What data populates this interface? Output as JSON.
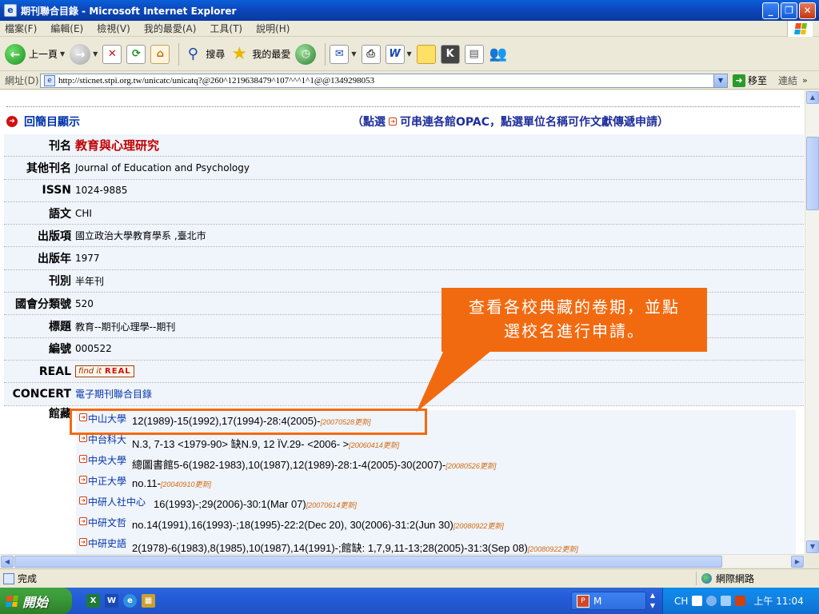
{
  "window": {
    "title": "期刊聯合目錄 - Microsoft Internet Explorer",
    "buttons": [
      "_",
      "❐",
      "✕"
    ]
  },
  "menu": [
    "檔案(F)",
    "編輯(E)",
    "檢視(V)",
    "我的最愛(A)",
    "工具(T)",
    "說明(H)"
  ],
  "toolbar": {
    "back_label": "上一頁",
    "search_label": "搜尋",
    "favorites_label": "我的最愛"
  },
  "address": {
    "label": "網址(D)",
    "url": "http://sticnet.stpi.org.tw/unicatc/unicatq?@260^1219638479^107^^^1^1@@1349298053",
    "go_label": "移至",
    "links_label": "連結"
  },
  "page": {
    "back_label": "回簡目顯示",
    "hint_prefix": "（點選",
    "hint_suffix": "可串連各館OPAC，點選單位名稱可作文獻傳遞申請）",
    "fields": [
      {
        "key": "刊名",
        "value": "教育與心理研究"
      },
      {
        "key": "其他刊名",
        "value": "Journal of Education and Psychology"
      },
      {
        "key": "ISSN",
        "value": "1024-9885"
      },
      {
        "key": "語文",
        "value": "CHI"
      },
      {
        "key": "出版項",
        "value": "國立政治大學教育學系 ,臺北市"
      },
      {
        "key": "出版年",
        "value": "1977"
      },
      {
        "key": "刊別",
        "value": "半年刊"
      },
      {
        "key": "國會分類號",
        "value": "520"
      },
      {
        "key": "標題",
        "value": "教育--期刊心理學--期刊"
      },
      {
        "key": "編號",
        "value": "000522"
      },
      {
        "key": "REAL",
        "findit": "find it",
        "real": "REAL"
      },
      {
        "key": "CONCERT",
        "value": "電子期刊聯合目錄"
      }
    ],
    "holdings_key": "館藏",
    "holdings": [
      {
        "lib": "中山大學",
        "vols": "12(1989)-15(1992),17(1994)-28:4(2005)-",
        "updated": "[20070528更新]"
      },
      {
        "lib": "中台科大",
        "vols": "N.3, 7-13 <1979-90> 缺N.9, 12 ÏV.29- <2006- >",
        "updated": "[20060414更新]"
      },
      {
        "lib": "中央大學",
        "vols": "總圖書館5-6(1982-1983),10(1987),12(1989)-28:1-4(2005)-30(2007)-",
        "updated": "[20080526更新]"
      },
      {
        "lib": "中正大學",
        "vols": "no.11-",
        "updated": "[20040910更新]"
      },
      {
        "lib": "中研人社中心",
        "vols": "16(1993)-;29(2006)-30:1(Mar 07)",
        "updated": "[20070614更新]"
      },
      {
        "lib": "中研文哲",
        "vols": "no.14(1991),16(1993)-;18(1995)-22:2(Dec 20), 30(2006)-31:2(Jun 30)",
        "updated": "[20080922更新]"
      },
      {
        "lib": "中研史語",
        "vols": "2(1978)-6(1983),8(1985),10(1987),14(1991)-;館缺: 1,7,9,11-13;28(2005)-31:3(Sep 08)",
        "updated": "[20080922更新]"
      }
    ]
  },
  "callout": {
    "line1": "查看各校典藏的卷期，並點",
    "line2": "選校名進行申請。"
  },
  "status": {
    "text": "完成",
    "zone": "網際網路"
  },
  "taskbar": {
    "start": "開始",
    "task_label": "M",
    "lang": "CH",
    "clock": "上午 11:04"
  },
  "colors": {
    "accent_orange": "#f26a10",
    "link_blue": "#0033aa",
    "title_red": "#c00000"
  }
}
